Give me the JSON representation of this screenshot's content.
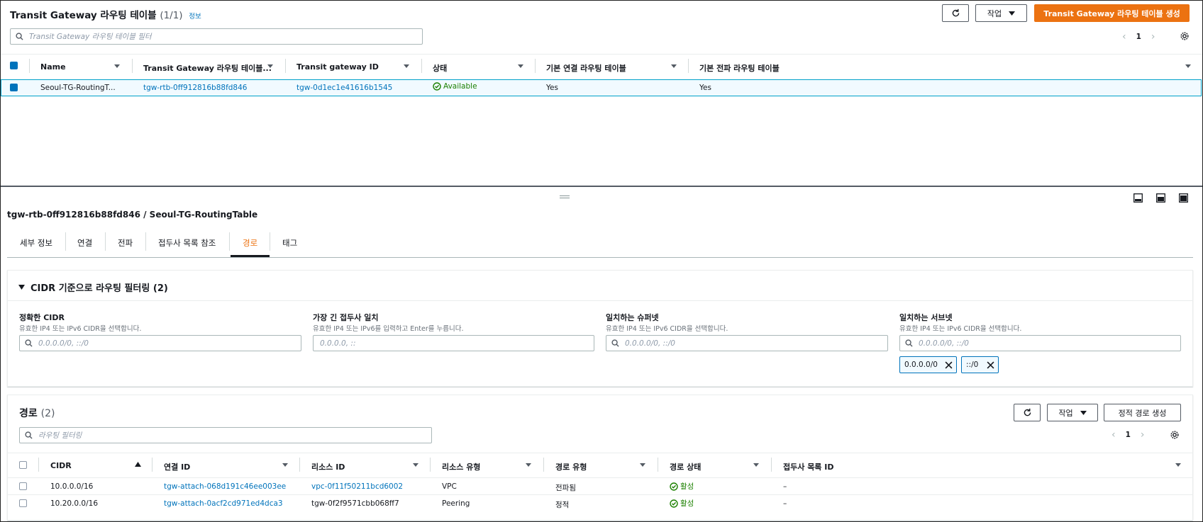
{
  "top": {
    "title": "Transit Gateway 라우팅 테이블",
    "count": "(1/1)",
    "info": "정보",
    "refresh_icon": "refresh-icon",
    "actions_label": "작업",
    "create_label": "Transit Gateway 라우팅 테이블 생성",
    "filter_placeholder": "Transit Gateway 라우팅 테이블 필터",
    "page": "1",
    "columns": [
      "Name",
      "Transit Gateway 라우팅 테이블...",
      "Transit gateway ID",
      "상태",
      "기본 연결 라우팅 테이블",
      "기본 전파 라우팅 테이블"
    ],
    "rows": [
      {
        "name": "Seoul-TG-RoutingT...",
        "rtb_id": "tgw-rtb-0ff912816b88fd846",
        "tgw_id": "tgw-0d1ec1e41616b1545",
        "status": "Available",
        "assoc": "Yes",
        "prop": "Yes"
      }
    ]
  },
  "detail": {
    "title": "tgw-rtb-0ff912816b88fd846 / Seoul-TG-RoutingTable",
    "tabs": [
      "세부 정보",
      "연결",
      "전파",
      "접두사 목록 참조",
      "경로",
      "태그"
    ],
    "active_tab": "경로",
    "filter_section": {
      "title": "CIDR 기준으로 라우팅 필터링 (2)",
      "fields": [
        {
          "label": "정확한 CIDR",
          "desc": "유효한 IP4 또는 IPv6 CIDR을 선택합니다.",
          "placeholder": "0.0.0.0/0, ::/0"
        },
        {
          "label": "가장 긴 접두사 일치",
          "desc": "유효한 IP4 또는 IPv6를 입력하고 Enter를 누릅니다.",
          "placeholder": "0.0.0.0, ::"
        },
        {
          "label": "일치하는 슈퍼넷",
          "desc": "유효한 IP4 또는 IPv6 CIDR을 선택합니다.",
          "placeholder": "0.0.0.0/0, ::/0"
        },
        {
          "label": "일치하는 서브넷",
          "desc": "유효한 IP4 또는 IPv6 CIDR을 선택합니다.",
          "placeholder": "0.0.0.0/0, ::/0"
        }
      ],
      "tokens": [
        "0.0.0.0/0",
        "::/0"
      ]
    },
    "routes": {
      "title": "경로",
      "count": "(2)",
      "actions_label": "작업",
      "create_label": "정적 경로 생성",
      "filter_placeholder": "라우팅 필터링",
      "page": "1",
      "columns": [
        "CIDR",
        "연결 ID",
        "리소스 ID",
        "리소스 유형",
        "경로 유형",
        "경로 상태",
        "접두사 목록 ID"
      ],
      "rows": [
        {
          "cidr": "10.0.0.0/16",
          "attach": "tgw-attach-068d191c46ee003ee",
          "resource": "vpc-0f11f50211bcd6002",
          "type": "VPC",
          "route_type": "전파됨",
          "state": "활성",
          "prefix": "–"
        },
        {
          "cidr": "10.20.0.0/16",
          "attach": "tgw-attach-0acf2cd971ed4dca3",
          "resource": "tgw-0f2f9571cbb068ff7",
          "type": "Peering",
          "route_type": "정적",
          "state": "활성",
          "prefix": "–"
        }
      ]
    }
  },
  "colors": {
    "accent": "#0073bb",
    "primary": "#ec7211",
    "success": "#1d8102",
    "active_tab": "#ec7211"
  }
}
